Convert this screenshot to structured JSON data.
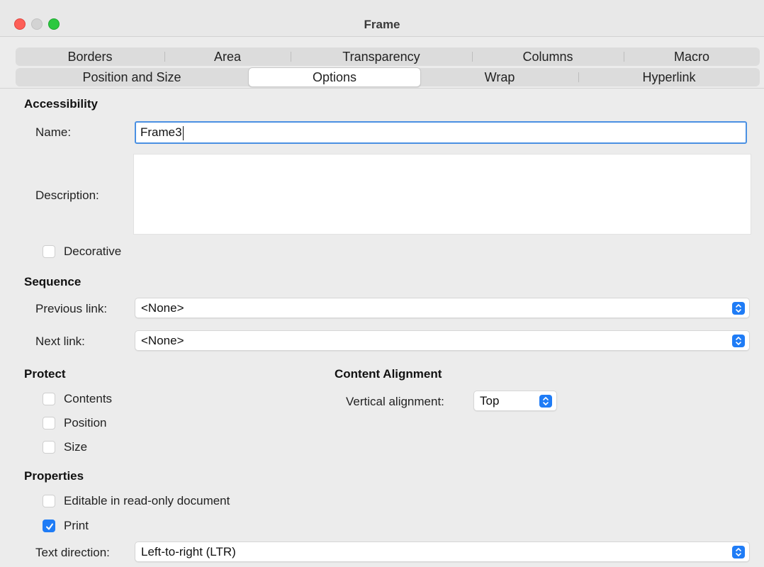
{
  "window": {
    "title": "Frame"
  },
  "tabs": {
    "row1": [
      "Borders",
      "Area",
      "Transparency",
      "Columns",
      "Macro"
    ],
    "row2": [
      "Position and Size",
      "Options",
      "Wrap",
      "Hyperlink"
    ],
    "active": "Options"
  },
  "accessibility": {
    "heading": "Accessibility",
    "name_label": "Name:",
    "name_value": "Frame3",
    "description_label": "Description:",
    "description_value": "",
    "decorative_label": "Decorative",
    "decorative_checked": false
  },
  "sequence": {
    "heading": "Sequence",
    "previous_label": "Previous link:",
    "previous_value": "<None>",
    "next_label": "Next link:",
    "next_value": "<None>"
  },
  "protect": {
    "heading": "Protect",
    "contents_label": "Contents",
    "contents_checked": false,
    "position_label": "Position",
    "position_checked": false,
    "size_label": "Size",
    "size_checked": false
  },
  "content_alignment": {
    "heading": "Content Alignment",
    "vertical_label": "Vertical alignment:",
    "vertical_value": "Top"
  },
  "properties": {
    "heading": "Properties",
    "editable_label": "Editable in read-only document",
    "editable_checked": false,
    "print_label": "Print",
    "print_checked": true,
    "text_direction_label": "Text direction:",
    "text_direction_value": "Left-to-right (LTR)"
  },
  "colors": {
    "accent": "#1f7cf6",
    "focus_ring": "#4a90e2"
  },
  "icons": {
    "stepper": "up-down-chevron-icon",
    "check": "checkmark-icon"
  }
}
